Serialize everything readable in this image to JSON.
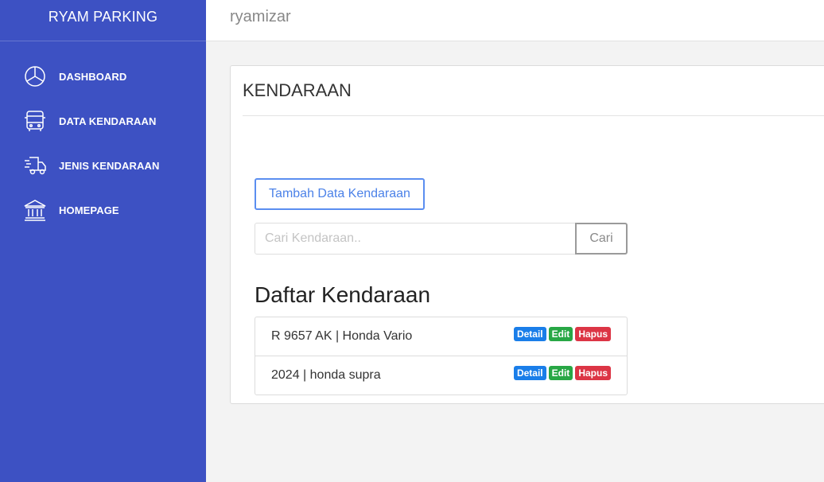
{
  "sidebar": {
    "brand": "RYAM PARKING",
    "items": [
      {
        "label": "DASHBOARD",
        "icon": "dashboard-pie-icon"
      },
      {
        "label": "DATA KENDARAAN",
        "icon": "bus-icon"
      },
      {
        "label": "JENIS KENDARAAN",
        "icon": "truck-icon"
      },
      {
        "label": "HOMEPAGE",
        "icon": "bank-icon"
      }
    ]
  },
  "topbar": {
    "username": "ryamizar"
  },
  "main": {
    "title": "KENDARAAN",
    "add_button": "Tambah Data Kendaraan",
    "search": {
      "placeholder": "Cari Kendaraan..",
      "value": "",
      "button": "Cari"
    },
    "list_title": "Daftar Kendaraan",
    "vehicles": [
      {
        "text": "R 9657 AK | Honda Vario",
        "detail": "Detail",
        "edit": "Edit",
        "delete": "Hapus"
      },
      {
        "text": "2024 | honda supra",
        "detail": "Detail",
        "edit": "Edit",
        "delete": "Hapus"
      }
    ]
  },
  "colors": {
    "sidebar": "#3d51c3",
    "primary": "#1a7ee9",
    "success": "#28a745",
    "danger": "#dc3545"
  }
}
